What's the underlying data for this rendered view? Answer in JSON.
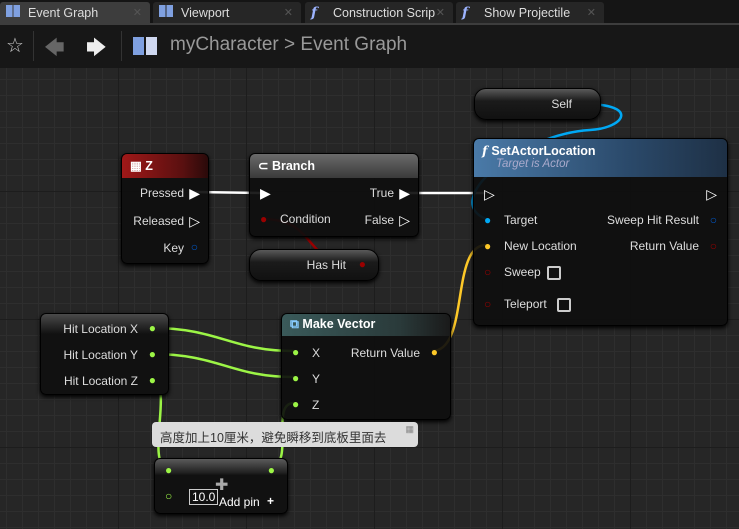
{
  "tabs": [
    {
      "label": "Event Graph",
      "icon": "grid-icon",
      "active": true
    },
    {
      "label": "Viewport",
      "icon": "grid-icon"
    },
    {
      "label": "Construction Scrip",
      "icon": "function-icon"
    },
    {
      "label": "Show Projectile",
      "icon": "function-icon"
    }
  ],
  "breadcrumb": {
    "owner": "myCharacter",
    "separator": ">",
    "page": "Event Graph"
  },
  "nodes": {
    "self": {
      "label": "Self"
    },
    "set_actor_location": {
      "title": "SetActorLocation",
      "subtitle": "Target is Actor",
      "pins": {
        "target": "Target",
        "new_location": "New Location",
        "sweep": "Sweep",
        "teleport": "Teleport",
        "sweep_hit_result": "Sweep Hit Result",
        "return_value": "Return Value"
      }
    },
    "key_z": {
      "title": "Z",
      "pins": {
        "pressed": "Pressed",
        "released": "Released",
        "key": "Key"
      }
    },
    "branch": {
      "title": "Branch",
      "pins": {
        "condition": "Condition",
        "true": "True",
        "false": "False"
      }
    },
    "has_hit": {
      "label": "Has Hit"
    },
    "hit_location": {
      "pins": [
        "Hit Location X",
        "Hit Location Y",
        "Hit Location Z"
      ]
    },
    "make_vector": {
      "title": "Make Vector",
      "pins": [
        "X",
        "Y",
        "Z"
      ],
      "return_value": "Return Value"
    },
    "comment": "高度加上10厘米，避免瞬移到底板里面去",
    "add": {
      "value": "10.0",
      "add_pin": "Add pin",
      "add_pin_icon": "+"
    }
  },
  "colors": {
    "exec": "#ffffff",
    "object": "#00a8f4",
    "vector": "#fdc828",
    "float": "#9cf546",
    "bool": "#9a0000",
    "struct": "#0059cb"
  }
}
